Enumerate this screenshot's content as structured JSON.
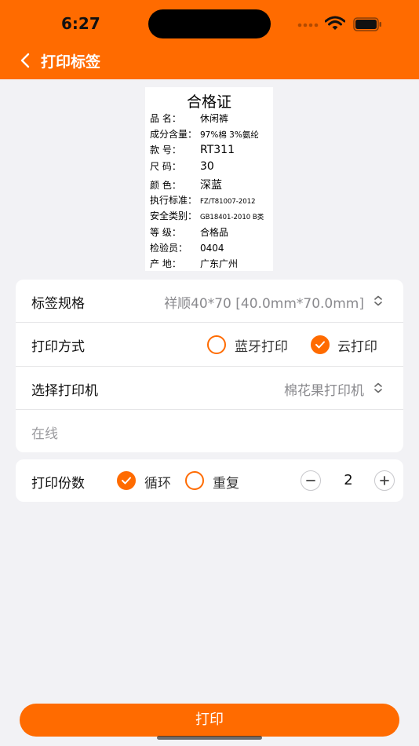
{
  "status_bar": {
    "time": "6:27"
  },
  "nav": {
    "title": "打印标签"
  },
  "label_preview": {
    "title": "合格证",
    "rows": [
      {
        "key": "品    名：",
        "value": "休闲裤"
      },
      {
        "key": "成分含量：",
        "value": "97%棉 3%氨纶"
      },
      {
        "key": "款    号：",
        "value": "RT311"
      },
      {
        "key": "尺    码：",
        "value": "30"
      },
      {
        "key": "颜    色：",
        "value": "深蓝"
      },
      {
        "key": "执行标准：",
        "value": "FZ/T81007-2012"
      },
      {
        "key": "安全类别：",
        "value": "GB18401-2010 B类"
      },
      {
        "key": "等    级：",
        "value": "合格品"
      },
      {
        "key": "检验员：",
        "value": "0404"
      },
      {
        "key": "产    地：",
        "value": "广东广州"
      }
    ]
  },
  "settings": {
    "label_spec": {
      "label": "标签规格",
      "value": "祥顺40*70 [40.0mm*70.0mm]"
    },
    "print_mode": {
      "label": "打印方式",
      "option_bluetooth": "蓝牙打印",
      "option_cloud": "云打印",
      "selected": "云打印"
    },
    "printer": {
      "label": "选择打印机",
      "value": "棉花果打印机"
    },
    "printer_status": "在线"
  },
  "copies": {
    "label": "打印份数",
    "option_loop": "循环",
    "option_repeat": "重复",
    "selected": "循环",
    "count": "2"
  },
  "print_button": {
    "label": "打印"
  },
  "colors": {
    "accent": "#ff6b00",
    "background": "#f2f2f5"
  }
}
